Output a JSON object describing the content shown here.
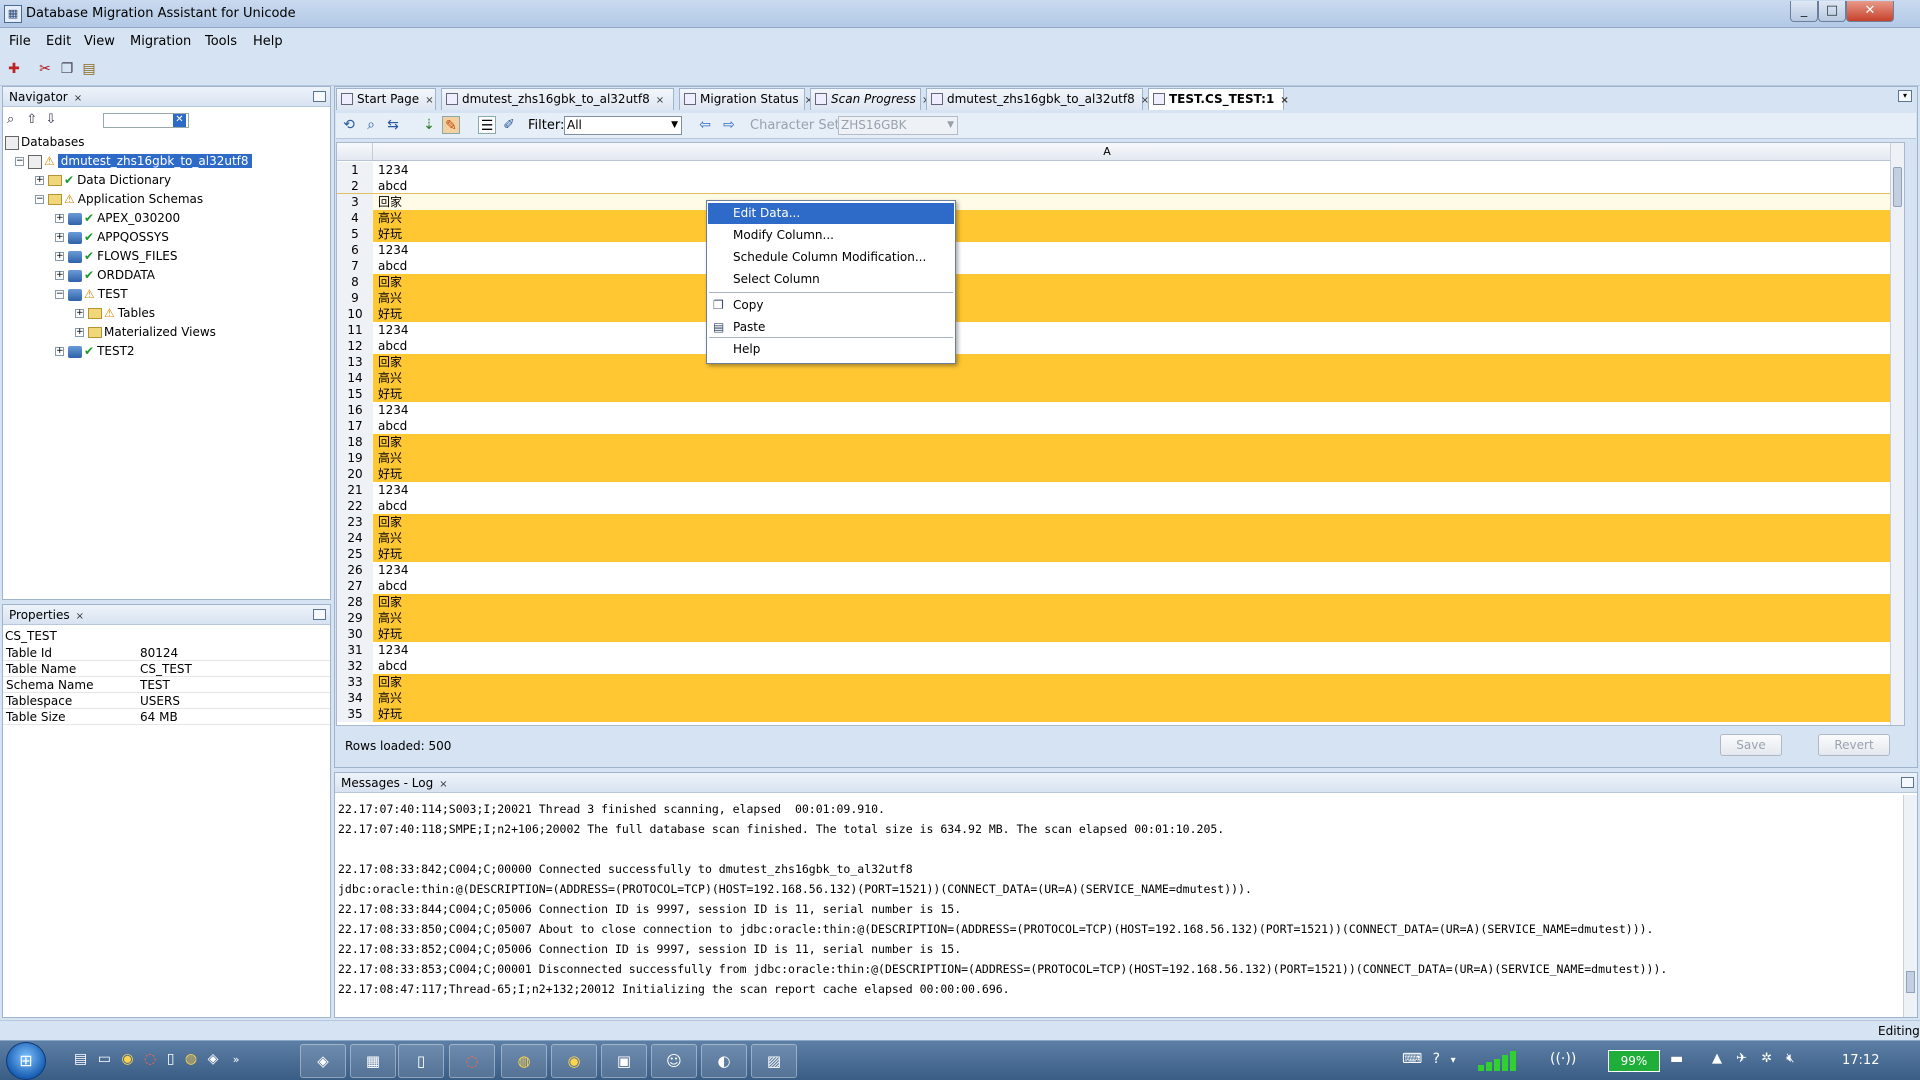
{
  "window": {
    "title": "Database Migration Assistant for Unicode",
    "min_glyph": "_",
    "max_glyph": "□",
    "close_glyph": "✕"
  },
  "menu": [
    {
      "label": "File"
    },
    {
      "label": "Edit"
    },
    {
      "label": "View"
    },
    {
      "label": "Migration"
    },
    {
      "label": "Tools"
    },
    {
      "label": "Help"
    }
  ],
  "toolbar_icons": [
    "new-connection-icon",
    "cut-icon",
    "copy-icon",
    "paste-icon"
  ],
  "navigator": {
    "title": "Navigator",
    "root_label": "Databases",
    "items": [
      {
        "label": "dmutest_zhs16gbk_to_al32utf8",
        "level": 1,
        "expander": "−",
        "status": "warning",
        "selected": true
      },
      {
        "label": "Data Dictionary",
        "level": 2,
        "expander": "+",
        "status": "ok"
      },
      {
        "label": "Application Schemas",
        "level": 2,
        "expander": "−",
        "status": "warning"
      },
      {
        "label": "APEX_030200",
        "level": 3,
        "expander": "+",
        "status": "ok"
      },
      {
        "label": "APPQOSSYS",
        "level": 3,
        "expander": "+",
        "status": "ok"
      },
      {
        "label": "FLOWS_FILES",
        "level": 3,
        "expander": "+",
        "status": "ok"
      },
      {
        "label": "ORDDATA",
        "level": 3,
        "expander": "+",
        "status": "ok"
      },
      {
        "label": "TEST",
        "level": 3,
        "expander": "−",
        "status": "warning"
      },
      {
        "label": "Tables",
        "level": 4,
        "expander": "+",
        "status": "warning"
      },
      {
        "label": "Materialized Views",
        "level": 4,
        "expander": "+",
        "status": "none"
      },
      {
        "label": "TEST2",
        "level": 3,
        "expander": "+",
        "status": "ok"
      }
    ]
  },
  "properties": {
    "title": "Properties",
    "object": "CS_TEST",
    "rows": [
      {
        "key": "Table Id",
        "value": "80124"
      },
      {
        "key": "Table Name",
        "value": "CS_TEST"
      },
      {
        "key": "Schema Name",
        "value": "TEST"
      },
      {
        "key": "Tablespace",
        "value": "USERS"
      },
      {
        "key": "Table Size",
        "value": "64 MB"
      }
    ]
  },
  "editor_tabs": [
    {
      "label": "Start Page",
      "active": false
    },
    {
      "label": "dmutest_zhs16gbk_to_al32utf8",
      "active": false
    },
    {
      "label": "Migration Status",
      "active": false
    },
    {
      "label": "Scan Progress",
      "active": false
    },
    {
      "label": "dmutest_zhs16gbk_to_al32utf8",
      "active": false
    },
    {
      "label": "TEST.CS_TEST:1",
      "active": true
    }
  ],
  "data_toolbar": {
    "filter_label": "Filter:",
    "filter_value": "All",
    "charset_label": "Character Set:",
    "charset_value": "ZHS16GBK"
  },
  "grid": {
    "column_header": "A",
    "rows": [
      {
        "n": "1",
        "v": "1234",
        "hl": false
      },
      {
        "n": "2",
        "v": "abcd",
        "hl": false
      },
      {
        "n": "3",
        "v": "回家",
        "hl": false
      },
      {
        "n": "4",
        "v": "高兴",
        "hl": true
      },
      {
        "n": "5",
        "v": "好玩",
        "hl": true
      },
      {
        "n": "6",
        "v": "1234",
        "hl": false
      },
      {
        "n": "7",
        "v": "abcd",
        "hl": false
      },
      {
        "n": "8",
        "v": "回家",
        "hl": true
      },
      {
        "n": "9",
        "v": "高兴",
        "hl": true
      },
      {
        "n": "10",
        "v": "好玩",
        "hl": true
      },
      {
        "n": "11",
        "v": "1234",
        "hl": false
      },
      {
        "n": "12",
        "v": "abcd",
        "hl": false
      },
      {
        "n": "13",
        "v": "回家",
        "hl": true
      },
      {
        "n": "14",
        "v": "高兴",
        "hl": true
      },
      {
        "n": "15",
        "v": "好玩",
        "hl": true
      },
      {
        "n": "16",
        "v": "1234",
        "hl": false
      },
      {
        "n": "17",
        "v": "abcd",
        "hl": false
      },
      {
        "n": "18",
        "v": "回家",
        "hl": true
      },
      {
        "n": "19",
        "v": "高兴",
        "hl": true
      },
      {
        "n": "20",
        "v": "好玩",
        "hl": true
      },
      {
        "n": "21",
        "v": "1234",
        "hl": false
      },
      {
        "n": "22",
        "v": "abcd",
        "hl": false
      },
      {
        "n": "23",
        "v": "回家",
        "hl": true
      },
      {
        "n": "24",
        "v": "高兴",
        "hl": true
      },
      {
        "n": "25",
        "v": "好玩",
        "hl": true
      },
      {
        "n": "26",
        "v": "1234",
        "hl": false
      },
      {
        "n": "27",
        "v": "abcd",
        "hl": false
      },
      {
        "n": "28",
        "v": "回家",
        "hl": true
      },
      {
        "n": "29",
        "v": "高兴",
        "hl": true
      },
      {
        "n": "30",
        "v": "好玩",
        "hl": true
      },
      {
        "n": "31",
        "v": "1234",
        "hl": false
      },
      {
        "n": "32",
        "v": "abcd",
        "hl": false
      },
      {
        "n": "33",
        "v": "回家",
        "hl": true
      },
      {
        "n": "34",
        "v": "高兴",
        "hl": true
      },
      {
        "n": "35",
        "v": "好玩",
        "hl": true
      }
    ],
    "rows_loaded": "Rows loaded: 500",
    "save_label": "Save",
    "revert_label": "Revert"
  },
  "context_menu": [
    {
      "label": "Edit Data...",
      "active": true,
      "icon": ""
    },
    {
      "label": "Modify Column...",
      "active": false,
      "icon": ""
    },
    {
      "label": "Schedule Column Modification...",
      "active": false,
      "icon": ""
    },
    {
      "label": "Select Column",
      "active": false,
      "icon": ""
    },
    {
      "label": "Copy",
      "active": false,
      "icon": "copy-icon"
    },
    {
      "label": "Paste",
      "active": false,
      "icon": "paste-icon"
    },
    {
      "label": "Help",
      "active": false,
      "icon": ""
    }
  ],
  "log": {
    "title": "Messages - Log",
    "lines": [
      "22.17:07:40:114;S003;I;20021 Thread 3 finished scanning, elapsed  00:01:09.910.",
      "22.17:07:40:118;SMPE;I;n2+106;20002 The full database scan finished. The total size is 634.92 MB. The scan elapsed 00:01:10.205.",
      "",
      "22.17:08:33:842;C004;C;00000 Connected successfully to dmutest_zhs16gbk_to_al32utf8",
      "jdbc:oracle:thin:@(DESCRIPTION=(ADDRESS=(PROTOCOL=TCP)(HOST=192.168.56.132)(PORT=1521))(CONNECT_DATA=(UR=A)(SERVICE_NAME=dmutest))).",
      "22.17:08:33:844;C004;C;05006 Connection ID is 9997, session ID is 11, serial number is 15.",
      "22.17:08:33:850;C004;C;05007 About to close connection to jdbc:oracle:thin:@(DESCRIPTION=(ADDRESS=(PROTOCOL=TCP)(HOST=192.168.56.132)(PORT=1521))(CONNECT_DATA=(UR=A)(SERVICE_NAME=dmutest))).",
      "22.17:08:33:852;C004;C;05006 Connection ID is 9997, session ID is 11, serial number is 15.",
      "22.17:08:33:853;C004;C;00001 Disconnected successfully from jdbc:oracle:thin:@(DESCRIPTION=(ADDRESS=(PROTOCOL=TCP)(HOST=192.168.56.132)(PORT=1521))(CONNECT_DATA=(UR=A)(SERVICE_NAME=dmutest))).",
      "22.17:08:47:117;Thread-65;I;n2+132;20012 Initializing the scan report cache elapsed 00:00:00.696."
    ]
  },
  "status": {
    "mode": "Editing"
  },
  "taskbar": {
    "battery": "99%",
    "clock": "17:12"
  }
}
